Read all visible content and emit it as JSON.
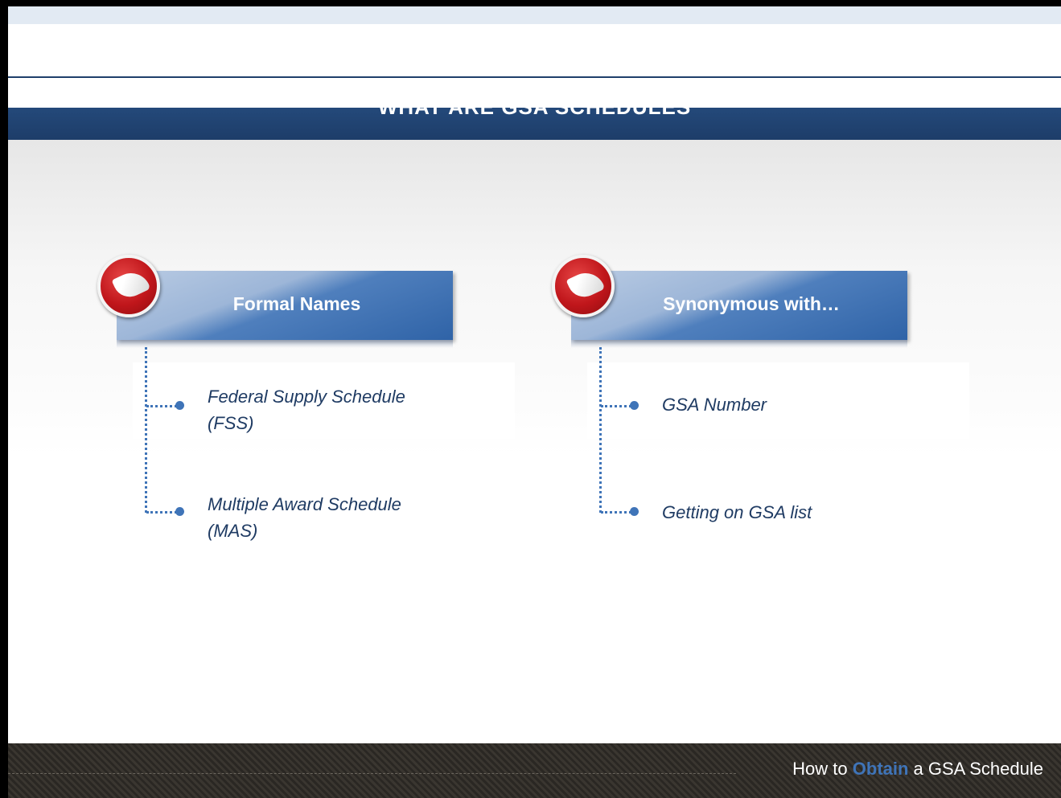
{
  "title": "WHAT ARE GSA SCHEDULES",
  "columns": [
    {
      "heading": "Formal Names",
      "items": [
        "Federal Supply Schedule (FSS)",
        "Multiple Award Schedule (MAS)"
      ]
    },
    {
      "heading": "Synonymous with…",
      "items": [
        "GSA Number",
        "Getting on GSA list"
      ]
    }
  ],
  "footer": {
    "prefix": "How to ",
    "accent": "Obtain",
    "suffix": " a GSA Schedule",
    "accent_color": "#3f74b8"
  },
  "icons": [
    "check-badge-icon",
    "check-badge-icon"
  ]
}
